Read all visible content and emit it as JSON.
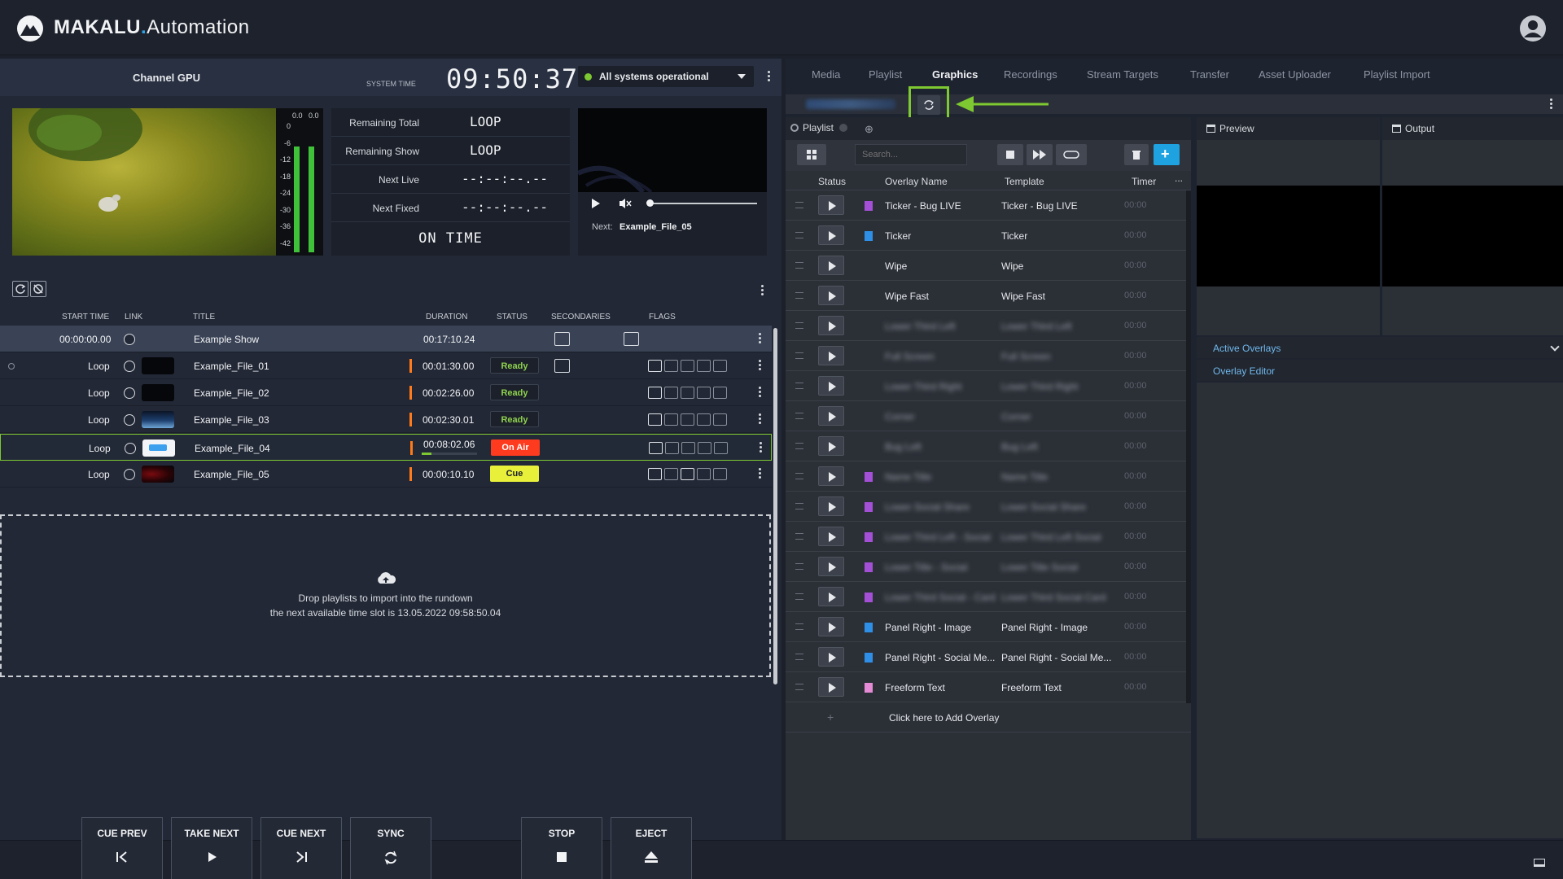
{
  "header": {
    "brand_bold": "MAKALU",
    "brand_dot": ".",
    "brand_rest": "Automation"
  },
  "channel": {
    "name": "Channel GPU",
    "system_time_label": "SYSTEM TIME",
    "clock": "09:50:37",
    "status": "All systems operational",
    "status_color": "#7ec831"
  },
  "meter": {
    "scale": [
      "0",
      "-6",
      "-12",
      "-18",
      "-24",
      "-30",
      "-36",
      "-42"
    ],
    "left_peak": "0.0",
    "right_peak": "0.0",
    "levels": [
      0.85,
      0.85
    ]
  },
  "timing": {
    "rows": [
      {
        "label": "Remaining Total",
        "value": "LOOP"
      },
      {
        "label": "Remaining Show",
        "value": "LOOP"
      },
      {
        "label": "Next Live",
        "value": "--:--:--.--"
      },
      {
        "label": "Next Fixed",
        "value": "--:--:--.--"
      }
    ],
    "on_time": "ON TIME"
  },
  "mini_player": {
    "next_label": "Next:",
    "next_value": "Example_File_05"
  },
  "rundown": {
    "columns": [
      "START TIME",
      "LINK",
      "TITLE",
      "DURATION",
      "STATUS",
      "SECONDARIES",
      "FLAGS"
    ],
    "show": {
      "start": "00:00:00.00",
      "title": "Example Show",
      "duration": "00:17:10.24"
    },
    "rows": [
      {
        "start": "Loop",
        "title": "Example_File_01",
        "duration": "00:01:30.00",
        "status": "Ready"
      },
      {
        "start": "Loop",
        "title": "Example_File_02",
        "duration": "00:02:26.00",
        "status": "Ready"
      },
      {
        "start": "Loop",
        "title": "Example_File_03",
        "duration": "00:02:30.01",
        "status": "Ready"
      },
      {
        "start": "Loop",
        "title": "Example_File_04",
        "duration": "00:08:02.06",
        "status": "On Air"
      },
      {
        "start": "Loop",
        "title": "Example_File_05",
        "duration": "00:00:10.10",
        "status": "Cue"
      }
    ],
    "on_air_progress": 0.18,
    "status_colors": {
      "Ready": "#8fd14f",
      "On Air": "#ff3b1f",
      "Cue": "#e8f03a"
    },
    "drop_line1": "Drop playlists to import into the rundown",
    "drop_line2": "the next available time slot is 13.05.2022 09:58:50.04"
  },
  "controls": [
    {
      "label": "CUE PREV",
      "icon": "skip-back-icon"
    },
    {
      "label": "TAKE NEXT",
      "icon": "play-icon"
    },
    {
      "label": "CUE NEXT",
      "icon": "skip-forward-icon"
    },
    {
      "label": "SYNC",
      "icon": "sync-icon"
    },
    {
      "label": "STOP",
      "icon": "stop-icon"
    },
    {
      "label": "EJECT",
      "icon": "eject-icon"
    }
  ],
  "tabs": [
    "Media",
    "Playlist",
    "Graphics",
    "Recordings",
    "Stream Targets",
    "Transfer",
    "Asset Uploader",
    "Playlist Import"
  ],
  "active_tab": "Graphics",
  "graphics": {
    "playlist_tab": "Playlist",
    "search_placeholder": "Search...",
    "columns": [
      "Status",
      "Overlay Name",
      "Template",
      "Timer",
      "..."
    ],
    "overlays": [
      {
        "name": "Ticker - Bug LIVE",
        "template": "Ticker - Bug LIVE",
        "timer": "00:00",
        "color": "#a34fd6",
        "blur": false
      },
      {
        "name": "Ticker",
        "template": "Ticker",
        "timer": "00:00",
        "color": "#2f8fe6",
        "blur": false
      },
      {
        "name": "Wipe",
        "template": "Wipe",
        "timer": "00:00",
        "color": "",
        "blur": false
      },
      {
        "name": "Wipe Fast",
        "template": "Wipe Fast",
        "timer": "00:00",
        "color": "",
        "blur": false
      },
      {
        "name": "Lower Third Left",
        "template": "Lower Third Left",
        "timer": "00:00",
        "color": "",
        "blur": true
      },
      {
        "name": "Full Screen",
        "template": "Full Screen",
        "timer": "00:00",
        "color": "",
        "blur": true
      },
      {
        "name": "Lower Third Right",
        "template": "Lower Third Right",
        "timer": "00:00",
        "color": "",
        "blur": true
      },
      {
        "name": "Corner",
        "template": "Corner",
        "timer": "00:00",
        "color": "",
        "blur": true
      },
      {
        "name": "Bug Left",
        "template": "Bug Left",
        "timer": "00:00",
        "color": "",
        "blur": true
      },
      {
        "name": "Name Title",
        "template": "Name Title",
        "timer": "00:00",
        "color": "#a34fd6",
        "blur": true
      },
      {
        "name": "Lower Social Share",
        "template": "Lower Social Share",
        "timer": "00:00",
        "color": "#a34fd6",
        "blur": true
      },
      {
        "name": "Lower Third Left - Social",
        "template": "Lower Third Left Social",
        "timer": "00:00",
        "color": "#a34fd6",
        "blur": true
      },
      {
        "name": "Lower Title - Social",
        "template": "Lower Title Social",
        "timer": "00:00",
        "color": "#a34fd6",
        "blur": true
      },
      {
        "name": "Lower Third Social - Card",
        "template": "Lower Third Social Card",
        "timer": "00:00",
        "color": "#a34fd6",
        "blur": true
      },
      {
        "name": "Panel Right - Image",
        "template": "Panel Right - Image",
        "timer": "00:00",
        "color": "#2f8fe6",
        "blur": false
      },
      {
        "name": "Panel Right - Social Me...",
        "template": "Panel Right - Social Me...",
        "timer": "00:00",
        "color": "#2f8fe6",
        "blur": false
      },
      {
        "name": "Freeform Text",
        "template": "Freeform Text",
        "timer": "00:00",
        "color": "#e58bd6",
        "blur": false
      }
    ],
    "add_overlay": "Click here to Add Overlay",
    "preview_title": "Preview",
    "output_title": "Output",
    "active_overlays": "Active Overlays",
    "overlay_editor": "Overlay Editor",
    "highlight_color": "#7ec831"
  }
}
